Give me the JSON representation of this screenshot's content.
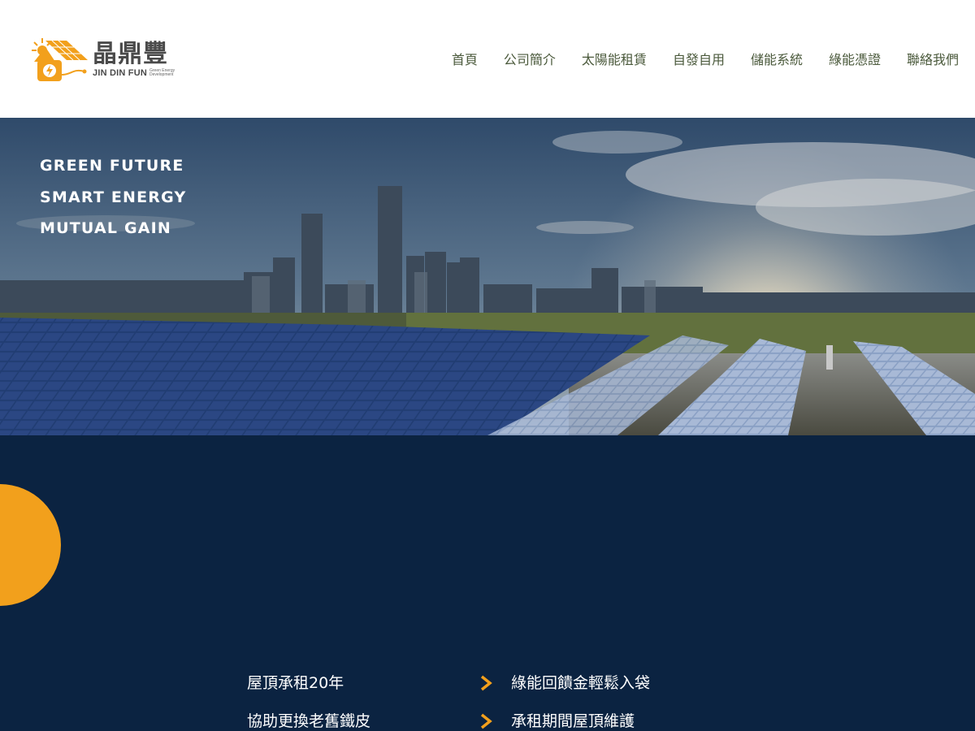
{
  "brand": {
    "name_cn": "晶鼎豐",
    "name_en": "JIN DIN FUN",
    "subtitle": "Green Energy Development",
    "accent_color": "#f2a01c",
    "text_color": "#4a4a4a"
  },
  "nav": {
    "items": [
      {
        "label": "首頁"
      },
      {
        "label": "公司簡介"
      },
      {
        "label": "太陽能租賃"
      },
      {
        "label": "自發自用"
      },
      {
        "label": "儲能系統"
      },
      {
        "label": "綠能憑證"
      },
      {
        "label": "聯絡我們"
      }
    ]
  },
  "hero": {
    "taglines": [
      "GREEN FUTURE",
      "SMART ENERGY",
      "MUTUAL GAIN"
    ]
  },
  "features": {
    "left": [
      "屋頂承租20年",
      "協助更換老舊鐵皮"
    ],
    "right": [
      "綠能回饋金輕鬆入袋",
      "承租期間屋頂維護"
    ],
    "section_color": "#0b2341",
    "arrow_icon": "chevron-right-icon"
  }
}
